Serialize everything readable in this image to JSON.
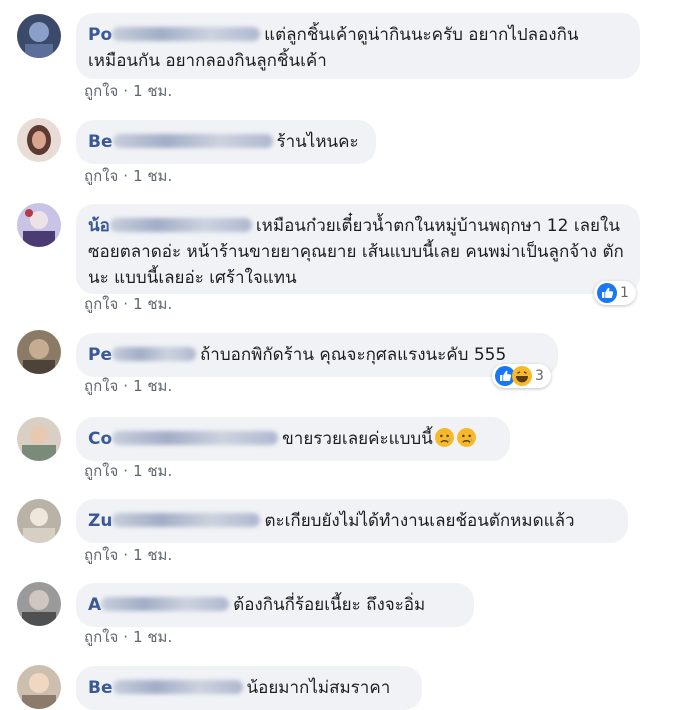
{
  "comments": [
    {
      "name": "Po",
      "text": "แต่ลูกชิ้นเค้าดูน่ากินนะครับ อยากไปลองกิน เหมือนกัน อยากลองกินลูกชิ้นเค้า",
      "meta": {
        "like": "ถูกใจ",
        "sep": "·",
        "time": "1 ชม."
      }
    },
    {
      "name": "Be",
      "text": "ร้านไหนคะ",
      "meta": {
        "like": "ถูกใจ",
        "sep": "·",
        "time": "1 ชม."
      }
    },
    {
      "name": "น้อ",
      "text": "เหมือนก๋วยเตี๋ยวน้ำตกในหมู่บ้านพฤกษา 12 เลยในซอยตลาดอ่ะ หน้าร้านขายยาคุณยาย เส้นแบบนี้เลย คนพม่าเป็นลูกจ้าง ตักนะ แบบนี้เลยอ่ะ เศร้าใจแทน",
      "meta": {
        "like": "ถูกใจ",
        "sep": "·",
        "time": "1 ชม."
      },
      "reactions": {
        "count": "1",
        "types": [
          "like-icon"
        ]
      }
    },
    {
      "name": "Pe",
      "text": "ถ้าบอกพิกัดร้าน คุณจะกุศลแรงนะคับ 555",
      "meta": {
        "like": "ถูกใจ",
        "sep": "·",
        "time": "1 ชม."
      },
      "reactions": {
        "count": "3",
        "types": [
          "like-icon",
          "haha-icon"
        ]
      }
    },
    {
      "name": "Co",
      "text": "ขายรวยเลยค่ะแบบนี้",
      "emojis": [
        "sad-face-icon",
        "sad-face-icon"
      ],
      "meta": {
        "like": "ถูกใจ",
        "sep": "·",
        "time": "1 ชม."
      }
    },
    {
      "name": "Zu",
      "text": "ตะเกียบยังไม่ได้ทำงานเลยช้อนตักหมดแล้ว",
      "meta": {
        "like": "ถูกใจ",
        "sep": "·",
        "time": "1 ชม."
      }
    },
    {
      "name": "A",
      "text": "ต้องกินกี่ร้อยเนี้ยะ ถึงจะอิ่ม",
      "meta": {
        "like": "ถูกใจ",
        "sep": "·",
        "time": "1 ชม."
      }
    },
    {
      "name": "Be",
      "text": "น้อยมากไม่สมราคา"
    }
  ],
  "colors": {
    "bubble": "#f0f2f5",
    "name": "#385898",
    "meta": "#606770",
    "like_blue": "#1877f2",
    "haha_yellow": "#f7b928"
  }
}
